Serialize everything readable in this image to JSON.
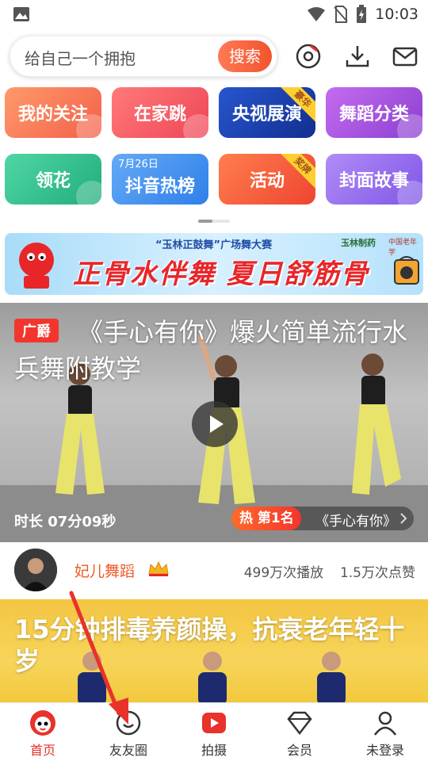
{
  "status_bar": {
    "time": "10:03"
  },
  "search": {
    "placeholder": "给自己一个拥抱",
    "button_label": "搜索"
  },
  "top_icons": [
    "record-icon",
    "download-icon",
    "message-icon"
  ],
  "categories": [
    {
      "label": "我的关注",
      "color": "#f5744e"
    },
    {
      "label": "在家跳",
      "color": "#f2525a"
    },
    {
      "label": "央视展演",
      "color": "#1b3fb0",
      "badge": "豪华"
    },
    {
      "label": "舞蹈分类",
      "color": "#a84bd9"
    },
    {
      "label": "领花",
      "color": "#2fbf8a"
    },
    {
      "label": "抖音热榜",
      "color": "#3d8ff0",
      "date": "7月26日"
    },
    {
      "label": "活动",
      "color": "#f25a3c",
      "badge": "奖牌"
    },
    {
      "label": "封面故事",
      "color": "#9a6af0"
    }
  ],
  "banner": {
    "subtitle": "“玉林正鼓舞”广场舞大赛",
    "headline": "正骨水伴舞 夏日舒筋骨",
    "logo_1": "玉林制药",
    "logo_2": "中国老年学"
  },
  "video": {
    "tag": "广爵",
    "title": "《手心有你》爆火简单流行水兵舞附教学",
    "duration": "时长 07分09秒",
    "rank_label": "热 第1名",
    "rank_song": "《手心有你》"
  },
  "author": {
    "name": "妃儿舞蹈",
    "plays": "499万次播放",
    "likes": "1.5万次点赞"
  },
  "card2": {
    "title": "15分钟排毒养颜操，抗衰老年轻十岁"
  },
  "nav": [
    {
      "label": "首页",
      "icon": "home-mascot-icon",
      "active": true
    },
    {
      "label": "友友圈",
      "icon": "smiley-icon",
      "active": false
    },
    {
      "label": "拍摄",
      "icon": "video-camera-icon",
      "active": false
    },
    {
      "label": "会员",
      "icon": "diamond-icon",
      "active": false
    },
    {
      "label": "未登录",
      "icon": "user-icon",
      "active": false
    }
  ],
  "colors": {
    "accent": "#e8322a",
    "search_button": "#f2542d",
    "arrow": "#e8322a"
  }
}
